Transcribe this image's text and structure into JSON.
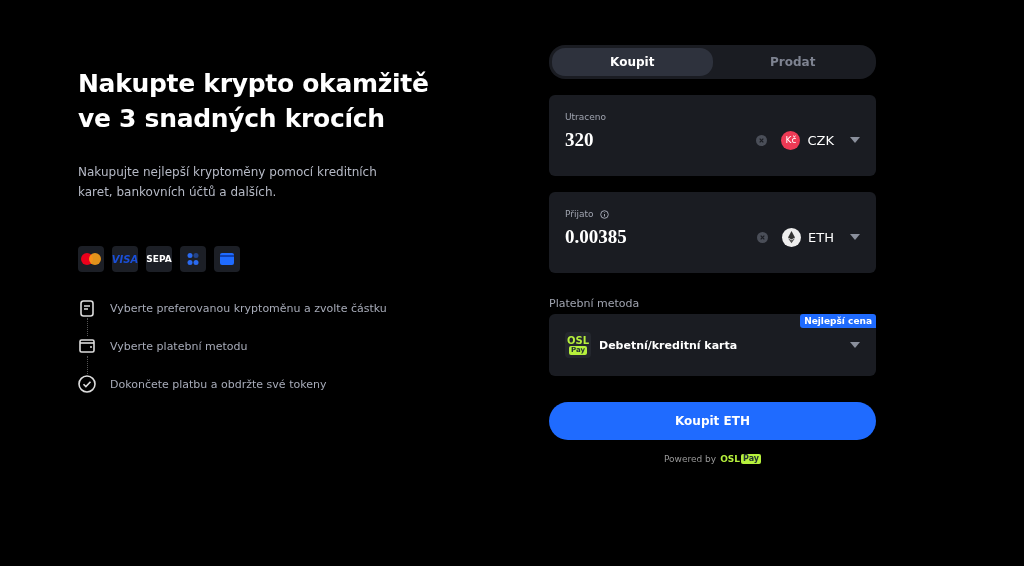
{
  "hero": {
    "title": "Nakupte krypto okamžitě ve 3 snadných krocích",
    "subtitle": "Nakupujte nejlepší kryptoměny pomocí kreditních karet, bankovních účtů a dalších."
  },
  "payment_methods": [
    {
      "kind": "mastercard"
    },
    {
      "kind": "visa",
      "text": "VISA"
    },
    {
      "kind": "sepa",
      "text": "SEPA"
    },
    {
      "kind": "dots"
    },
    {
      "kind": "wallet"
    }
  ],
  "steps": [
    {
      "kind": "document",
      "text": "Vyberte preferovanou kryptoměnu a zvolte částku"
    },
    {
      "kind": "wallet",
      "text": "Vyberte platební metodu"
    },
    {
      "kind": "check",
      "text": "Dokončete platbu a obdržte své tokeny"
    }
  ],
  "tabs": [
    {
      "label": "Koupit",
      "selected": true
    },
    {
      "label": "Prodat",
      "selected": false
    }
  ],
  "amounts": [
    {
      "label": "Utraceno",
      "info": false,
      "value": "320",
      "currency": "CZK",
      "badge": "Kč",
      "kind": "fiat"
    },
    {
      "label": "Přijato",
      "info": true,
      "value": "0.00385",
      "currency": "ETH",
      "kind": "eth"
    }
  ],
  "payment": {
    "label": "Platební metoda",
    "method": "Debetní/kreditní karta",
    "logo_top": "OSL",
    "logo_bottom": "Pay",
    "tag": "Nejlepší cena"
  },
  "buy_button": "Koupit ETH",
  "powered": {
    "text": "Powered by",
    "logo_top": "OSL",
    "logo_bottom": "Pay"
  }
}
